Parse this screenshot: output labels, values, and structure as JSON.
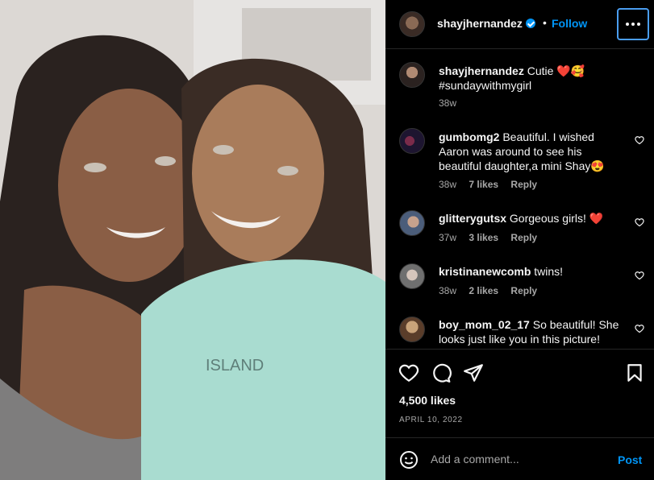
{
  "post": {
    "username": "shayjhernandez",
    "follow_label": "Follow",
    "separator": "•",
    "caption_user": "shayjhernandez",
    "caption_text": "Cutie ❤️🥰",
    "caption_tag": "#sundaywithmygirl",
    "caption_time": "38w",
    "likes": "4,500 likes",
    "date": "APRIL 10, 2022"
  },
  "comments": [
    {
      "user": "gumbomg2",
      "text": "Beautiful. I wished Aaron was around to see his beautiful daughter,a mini Shay😍",
      "time": "38w",
      "likes": "7 likes",
      "reply": "Reply"
    },
    {
      "user": "glitterygutsx",
      "text": "Gorgeous girls! ❤️",
      "time": "37w",
      "likes": "3 likes",
      "reply": "Reply"
    },
    {
      "user": "kristinanewcomb",
      "text": "twins!",
      "time": "38w",
      "likes": "2 likes",
      "reply": "Reply"
    },
    {
      "user": "boy_mom_02_17",
      "text": "So beautiful! She looks just like you in this picture!"
    }
  ],
  "add_comment": {
    "placeholder": "Add a comment...",
    "post_label": "Post"
  },
  "photo": {
    "sweatshirt_text": "ISLAND"
  },
  "icons": {
    "more": "more-options-icon",
    "verified": "verified-badge-icon",
    "like": "heart-outline-icon",
    "comment": "comment-bubble-icon",
    "share": "paper-plane-icon",
    "save": "bookmark-icon",
    "emoji": "emoji-smiley-icon"
  },
  "colors": {
    "background": "#000000",
    "accent": "#0095f6",
    "muted": "#a8a8a8",
    "text": "#f5f5f5"
  }
}
